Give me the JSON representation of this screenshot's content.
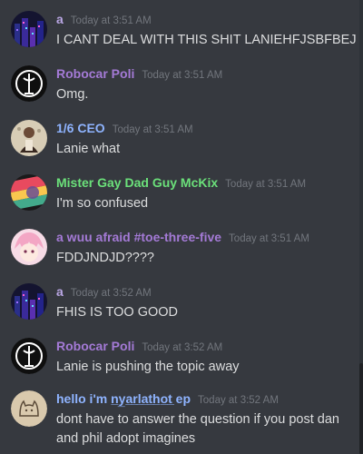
{
  "messages": [
    {
      "user": "a",
      "time": "Today at 3:51 AM",
      "text": "I CANT DEAL WITH THIS SHIT LANIEHFJSBFBEJ",
      "color": "#b9a6e3",
      "avatar": "neon-city-avatar"
    },
    {
      "user": "Robocar Poli",
      "time": "Today at 3:51 AM",
      "text": "Omg.",
      "color": "#a47ad6",
      "avatar": "emblem-avatar"
    },
    {
      "user": "1/6 CEO",
      "time": "Today at 3:51 AM",
      "text": "Lanie what",
      "color": "#8fb4ff",
      "avatar": "photo-avatar"
    },
    {
      "user": "Mister Gay Dad Guy McKix",
      "time": "Today at 3:51 AM",
      "text": "I'm so confused",
      "color": "#6be07a",
      "avatar": "colorful-avatar"
    },
    {
      "user": "a wuu afraid #toe-three-five",
      "time": "Today at 3:51 AM",
      "text": "FDDJNDJD????",
      "color": "#a47ad6",
      "avatar": "anime-avatar"
    },
    {
      "user": "a",
      "time": "Today at 3:52 AM",
      "text": "FHIS IS TOO GOOD",
      "color": "#b9a6e3",
      "avatar": "neon-city-avatar"
    },
    {
      "user": "Robocar Poli",
      "time": "Today at 3:52 AM",
      "text": "Lanie is pushing the topic away",
      "color": "#a47ad6",
      "avatar": "emblem-avatar"
    },
    {
      "user": "hello i'm n̲y̲a̲r̲l̲a̲t̲h̲o̲t̲ ep",
      "time": "Today at 3:52 AM",
      "text": "dont have to answer the question if you post dan and phil adopt imagines",
      "color": "#8fb4ff",
      "avatar": "cat-doodle-avatar"
    }
  ]
}
